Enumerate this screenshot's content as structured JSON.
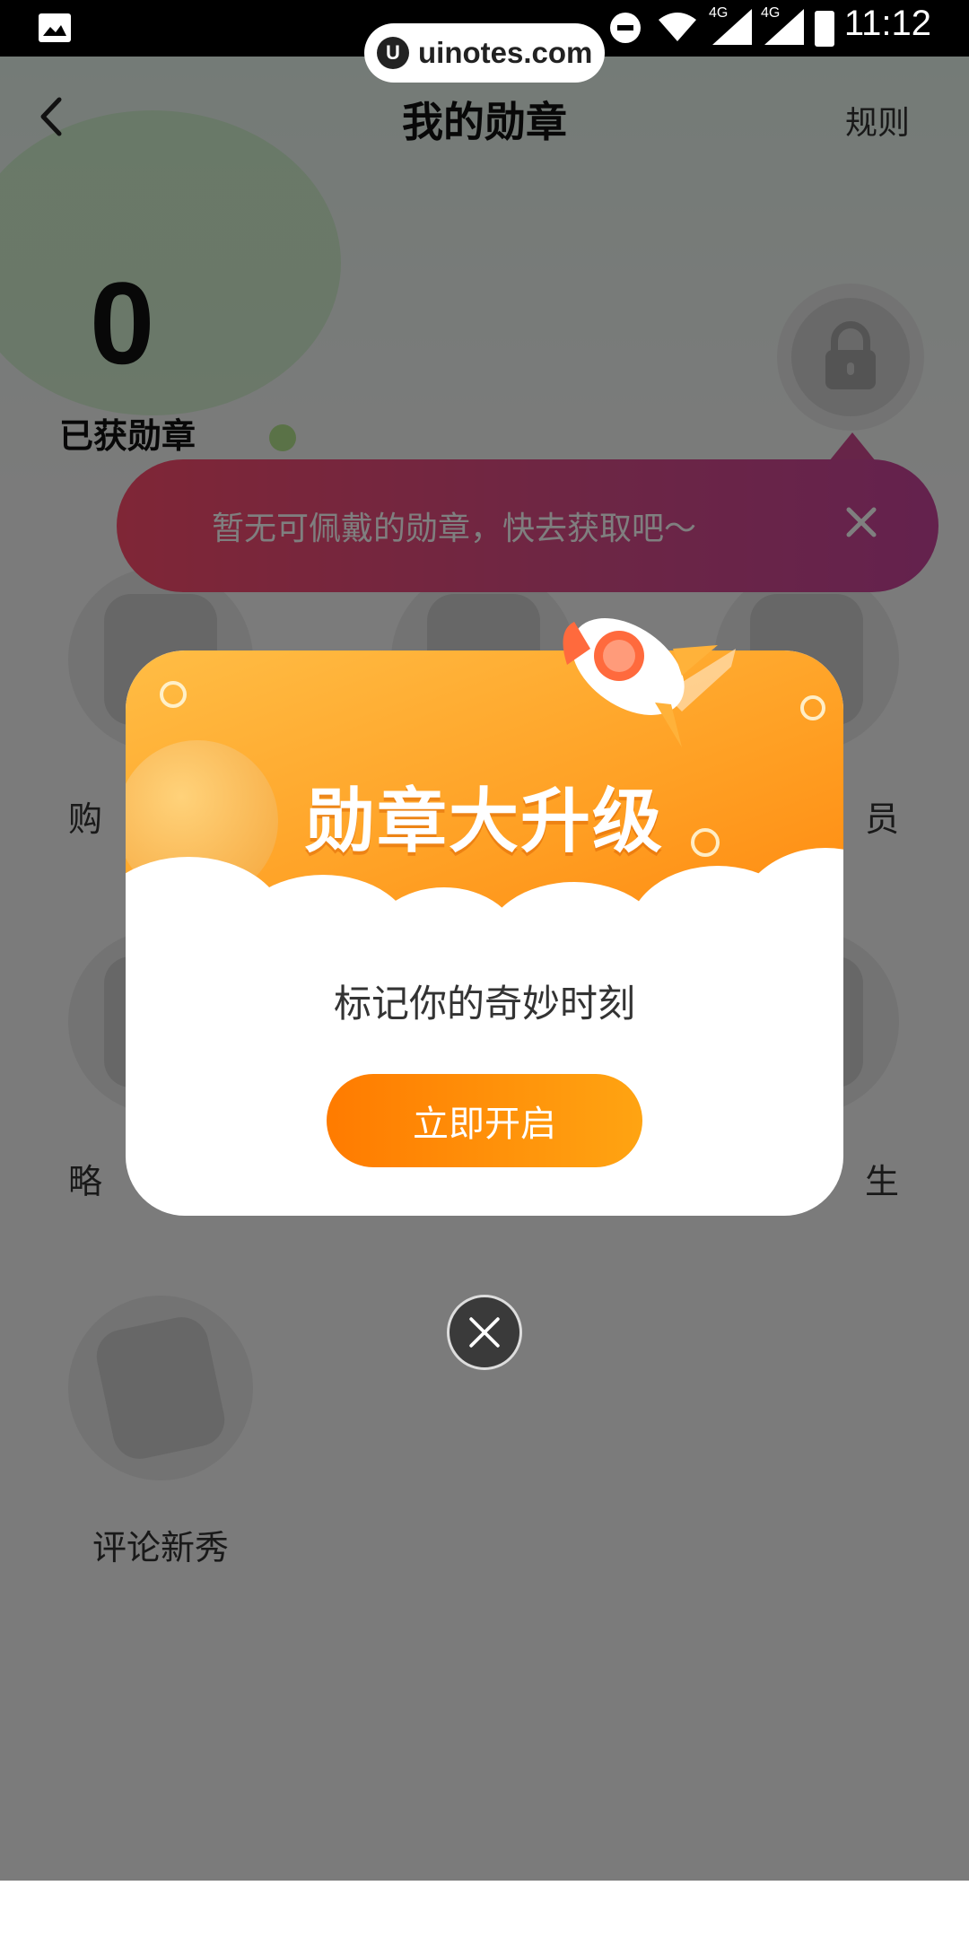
{
  "status_bar": {
    "time": "11:12",
    "signal_label_1": "4G",
    "signal_label_2": "4G"
  },
  "watermark": {
    "text": "uinotes.com"
  },
  "header": {
    "title": "我的勋章",
    "rules_label": "规则"
  },
  "summary": {
    "count": "0",
    "count_label": "已获勋章"
  },
  "toast": {
    "text": "暂无可佩戴的勋章，快去获取吧～"
  },
  "badges": [
    {
      "label": "购"
    },
    {
      "label": "员"
    },
    {
      "label": "略"
    },
    {
      "label": "生"
    },
    {
      "label": "评论新秀"
    }
  ],
  "modal": {
    "banner_title": "勋章大升级",
    "subtitle": "标记你的奇妙时刻",
    "cta_label": "立即开启"
  },
  "colors": {
    "toast_gradient_start": "#ff4d6d",
    "toast_gradient_end": "#c8449b",
    "banner_orange": "#ffa024",
    "cta_start": "#ff7b00",
    "cta_end": "#ffa412"
  }
}
